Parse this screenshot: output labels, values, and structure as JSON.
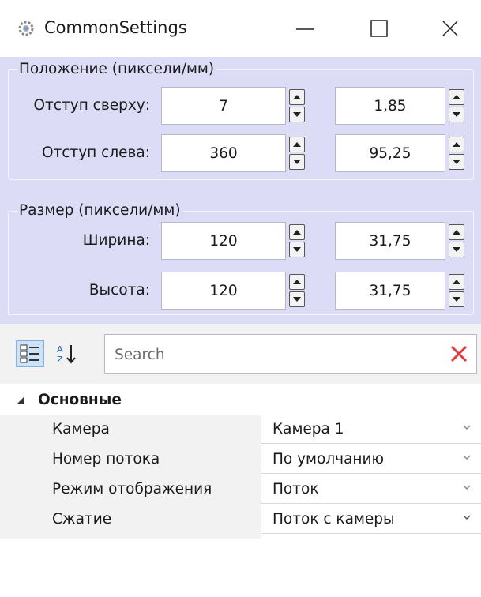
{
  "window": {
    "title": "CommonSettings",
    "app_icon": "gear-icon",
    "controls": {
      "minimize": "—",
      "maximize": "☐",
      "close": "✕"
    }
  },
  "position_group": {
    "label": "Положение (пиксели/мм)",
    "rows": [
      {
        "label": "Отступ сверху:",
        "px": "7",
        "mm": "1,85"
      },
      {
        "label": "Отступ слева:",
        "px": "360",
        "mm": "95,25"
      }
    ]
  },
  "size_group": {
    "label": "Размер (пиксели/мм)",
    "rows": [
      {
        "label": "Ширина:",
        "px": "120",
        "mm": "31,75"
      },
      {
        "label": "Высота:",
        "px": "120",
        "mm": "31,75"
      }
    ]
  },
  "toolbar": {
    "categorized_icon": "categorized-view-icon",
    "alphabetical_icon": "sort-az-icon",
    "search_placeholder": "Search",
    "clear_icon": "clear-x-icon"
  },
  "properties": {
    "category": "Основные",
    "items": [
      {
        "name": "Камера",
        "value": "Камера 1"
      },
      {
        "name": "Номер потока",
        "value": "По умолчанию"
      },
      {
        "name": "Режим отображения",
        "value": "Поток"
      },
      {
        "name": "Сжатие",
        "value": "Поток с камеры"
      }
    ]
  },
  "colors": {
    "panel_bg": "#dcdcf7",
    "clear_icon": "#e0393b"
  }
}
